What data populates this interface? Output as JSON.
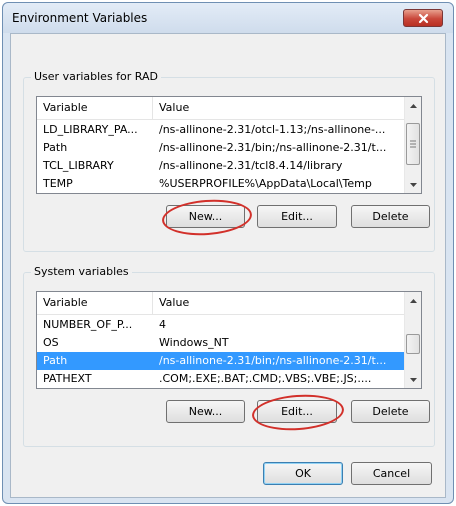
{
  "window": {
    "title": "Environment Variables",
    "close_label": "X"
  },
  "user_vars": {
    "group_label": "User variables for RAD",
    "columns": [
      "Variable",
      "Value"
    ],
    "rows": [
      {
        "variable": "LD_LIBRARY_PA...",
        "value": "/ns-allinone-2.31/otcl-1.13;/ns-allinone-..."
      },
      {
        "variable": "Path",
        "value": "/ns-allinone-2.31/bin;/ns-allinone-2.31/t..."
      },
      {
        "variable": "TCL_LIBRARY",
        "value": "/ns-allinone-2.31/tcl8.4.14/library"
      },
      {
        "variable": "TEMP",
        "value": "%USERPROFILE%\\AppData\\Local\\Temp"
      }
    ],
    "new_label": "New...",
    "edit_label": "Edit...",
    "delete_label": "Delete"
  },
  "system_vars": {
    "group_label": "System variables",
    "columns": [
      "Variable",
      "Value"
    ],
    "rows": [
      {
        "variable": "NUMBER_OF_P...",
        "value": "4"
      },
      {
        "variable": "OS",
        "value": "Windows_NT"
      },
      {
        "variable": "Path",
        "value": "/ns-allinone-2.31/bin;/ns-allinone-2.31/t...",
        "selected": true
      },
      {
        "variable": "PATHEXT",
        "value": ".COM;.EXE;.BAT;.CMD;.VBS;.VBE;.JS;...."
      }
    ],
    "new_label": "New...",
    "edit_label": "Edit...",
    "delete_label": "Delete"
  },
  "dialog": {
    "ok_label": "OK",
    "cancel_label": "Cancel"
  },
  "colors": {
    "selection": "#3399ff",
    "annotation_red": "#d2302a",
    "close_red": "#c9473a"
  },
  "icons": {
    "close": "close-icon",
    "scroll_up": "scroll-up-arrow-icon",
    "scroll_down": "scroll-down-arrow-icon",
    "thumb_grip": "scroll-thumb-grip-icon"
  }
}
